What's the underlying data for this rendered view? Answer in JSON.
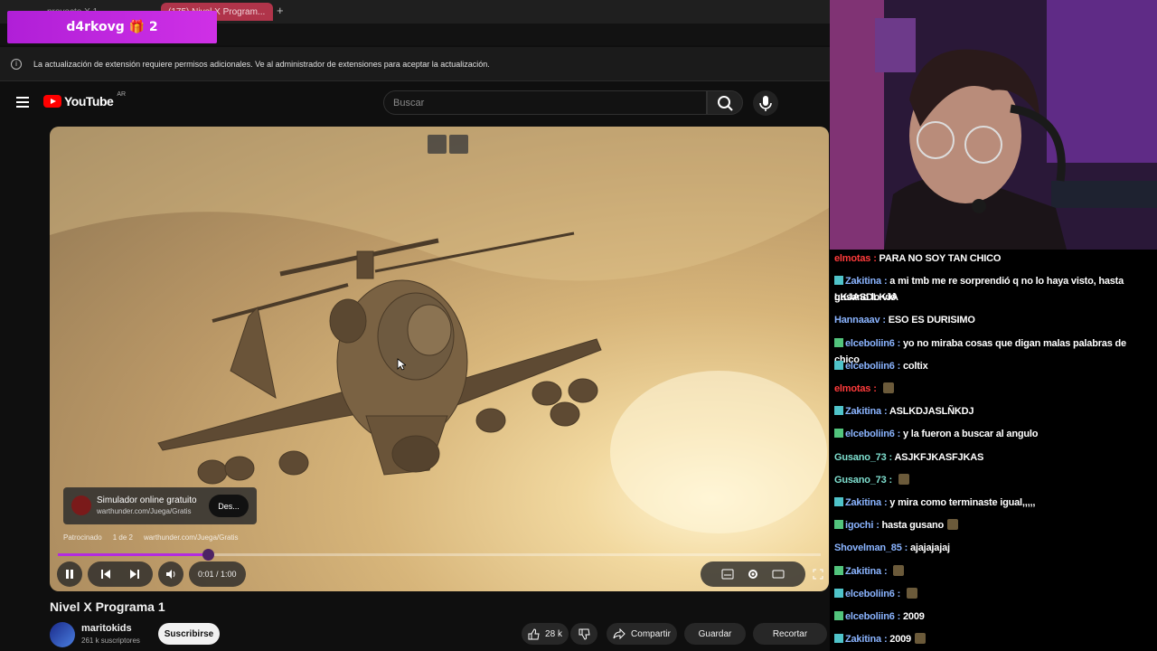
{
  "browser": {
    "tabs": [
      {
        "label": "proyecto X 1 ..."
      },
      {
        "label": "(175) Nivel X Program..."
      }
    ],
    "new_tab": "+"
  },
  "overlay_badge": {
    "text": "d4rkovg 🎁 2"
  },
  "infobar": {
    "text": "La actualización de extensión requiere permisos adicionales. Ve al administrador de extensiones para aceptar la actualización.",
    "icon": "info-icon"
  },
  "youtube": {
    "logo_text": "YouTube",
    "region": "AR",
    "search_placeholder": "Buscar"
  },
  "ad": {
    "title": "Simulador online gratuito",
    "url": "warthunder.com/Juega/Gratis",
    "button": "Des...",
    "meta_sponsored": "Patrocinado",
    "meta_count": "1 de 2",
    "meta_url": "warthunder.com/Juega/Gratis"
  },
  "player": {
    "time": "0:01 / 1:00",
    "progress_fraction": 0.0167,
    "accent": "#b32be0"
  },
  "video": {
    "title": "Nivel X Programa 1",
    "channel": "maritokids",
    "subscribers": "261 k suscriptores",
    "subscribe_label": "Suscribirse",
    "likes": "28 k",
    "share_label": "Compartir",
    "save_label": "Guardar",
    "clip_label": "Recortar"
  },
  "chat": {
    "messages": [
      {
        "user": "elmotas",
        "color": "#ff3b3b",
        "text": "PARA NO SOY TAN CHICO",
        "badge": false,
        "emote": false
      },
      {
        "user": "Zakitina",
        "color": "#8ab4ff",
        "text": "a mi tmb me re sorprendió q no lo haya visto, hasta gusano lo vió",
        "badge": true,
        "emote": false
      },
      {
        "user": "",
        "color": "#fff",
        "text": "LKJASDLKJA",
        "badge": false,
        "emote": false
      },
      {
        "user": "Hannaaav",
        "color": "#8ab4ff",
        "text": "ESO ES DURISIMO",
        "badge": false,
        "emote": false
      },
      {
        "user": "elceboliin6",
        "color": "#8ab4ff",
        "text": "yo no miraba cosas que digan malas palabras de chico",
        "badge": true,
        "emote": false
      },
      {
        "user": "elceboliin6",
        "color": "#8ab4ff",
        "text": "coltix",
        "badge": true,
        "emote": false
      },
      {
        "user": "elmotas",
        "color": "#ff3b3b",
        "text": "",
        "badge": false,
        "emote": true
      },
      {
        "user": "Zakitina",
        "color": "#8ab4ff",
        "text": "ASLKDJASLÑKDJ",
        "badge": true,
        "emote": false
      },
      {
        "user": "elceboliin6",
        "color": "#8ab4ff",
        "text": "y la fueron a buscar al angulo",
        "badge": true,
        "emote": false
      },
      {
        "user": "Gusano_73",
        "color": "#7fe0d0",
        "text": "ASJKFJKASFJKAS",
        "badge": false,
        "emote": false
      },
      {
        "user": "Gusano_73",
        "color": "#7fe0d0",
        "text": "",
        "badge": false,
        "emote": true
      },
      {
        "user": "Zakitina",
        "color": "#8ab4ff",
        "text": "y mira como terminaste igual,,,,,",
        "badge": true,
        "emote": false
      },
      {
        "user": "igochi",
        "color": "#8ab4ff",
        "text": "hasta gusano",
        "badge": true,
        "emote": true
      },
      {
        "user": "Shovelman_85",
        "color": "#8ab4ff",
        "text": "ajajajajaj",
        "badge": false,
        "emote": false
      },
      {
        "user": "Zakitina",
        "color": "#8ab4ff",
        "text": "",
        "badge": true,
        "emote": true
      },
      {
        "user": "elceboliin6",
        "color": "#8ab4ff",
        "text": "",
        "badge": true,
        "emote": true
      },
      {
        "user": "elceboliin6",
        "color": "#8ab4ff",
        "text": "2009",
        "badge": true,
        "emote": false
      },
      {
        "user": "Zakitina",
        "color": "#8ab4ff",
        "text": "2009",
        "badge": true,
        "emote": true
      }
    ]
  }
}
